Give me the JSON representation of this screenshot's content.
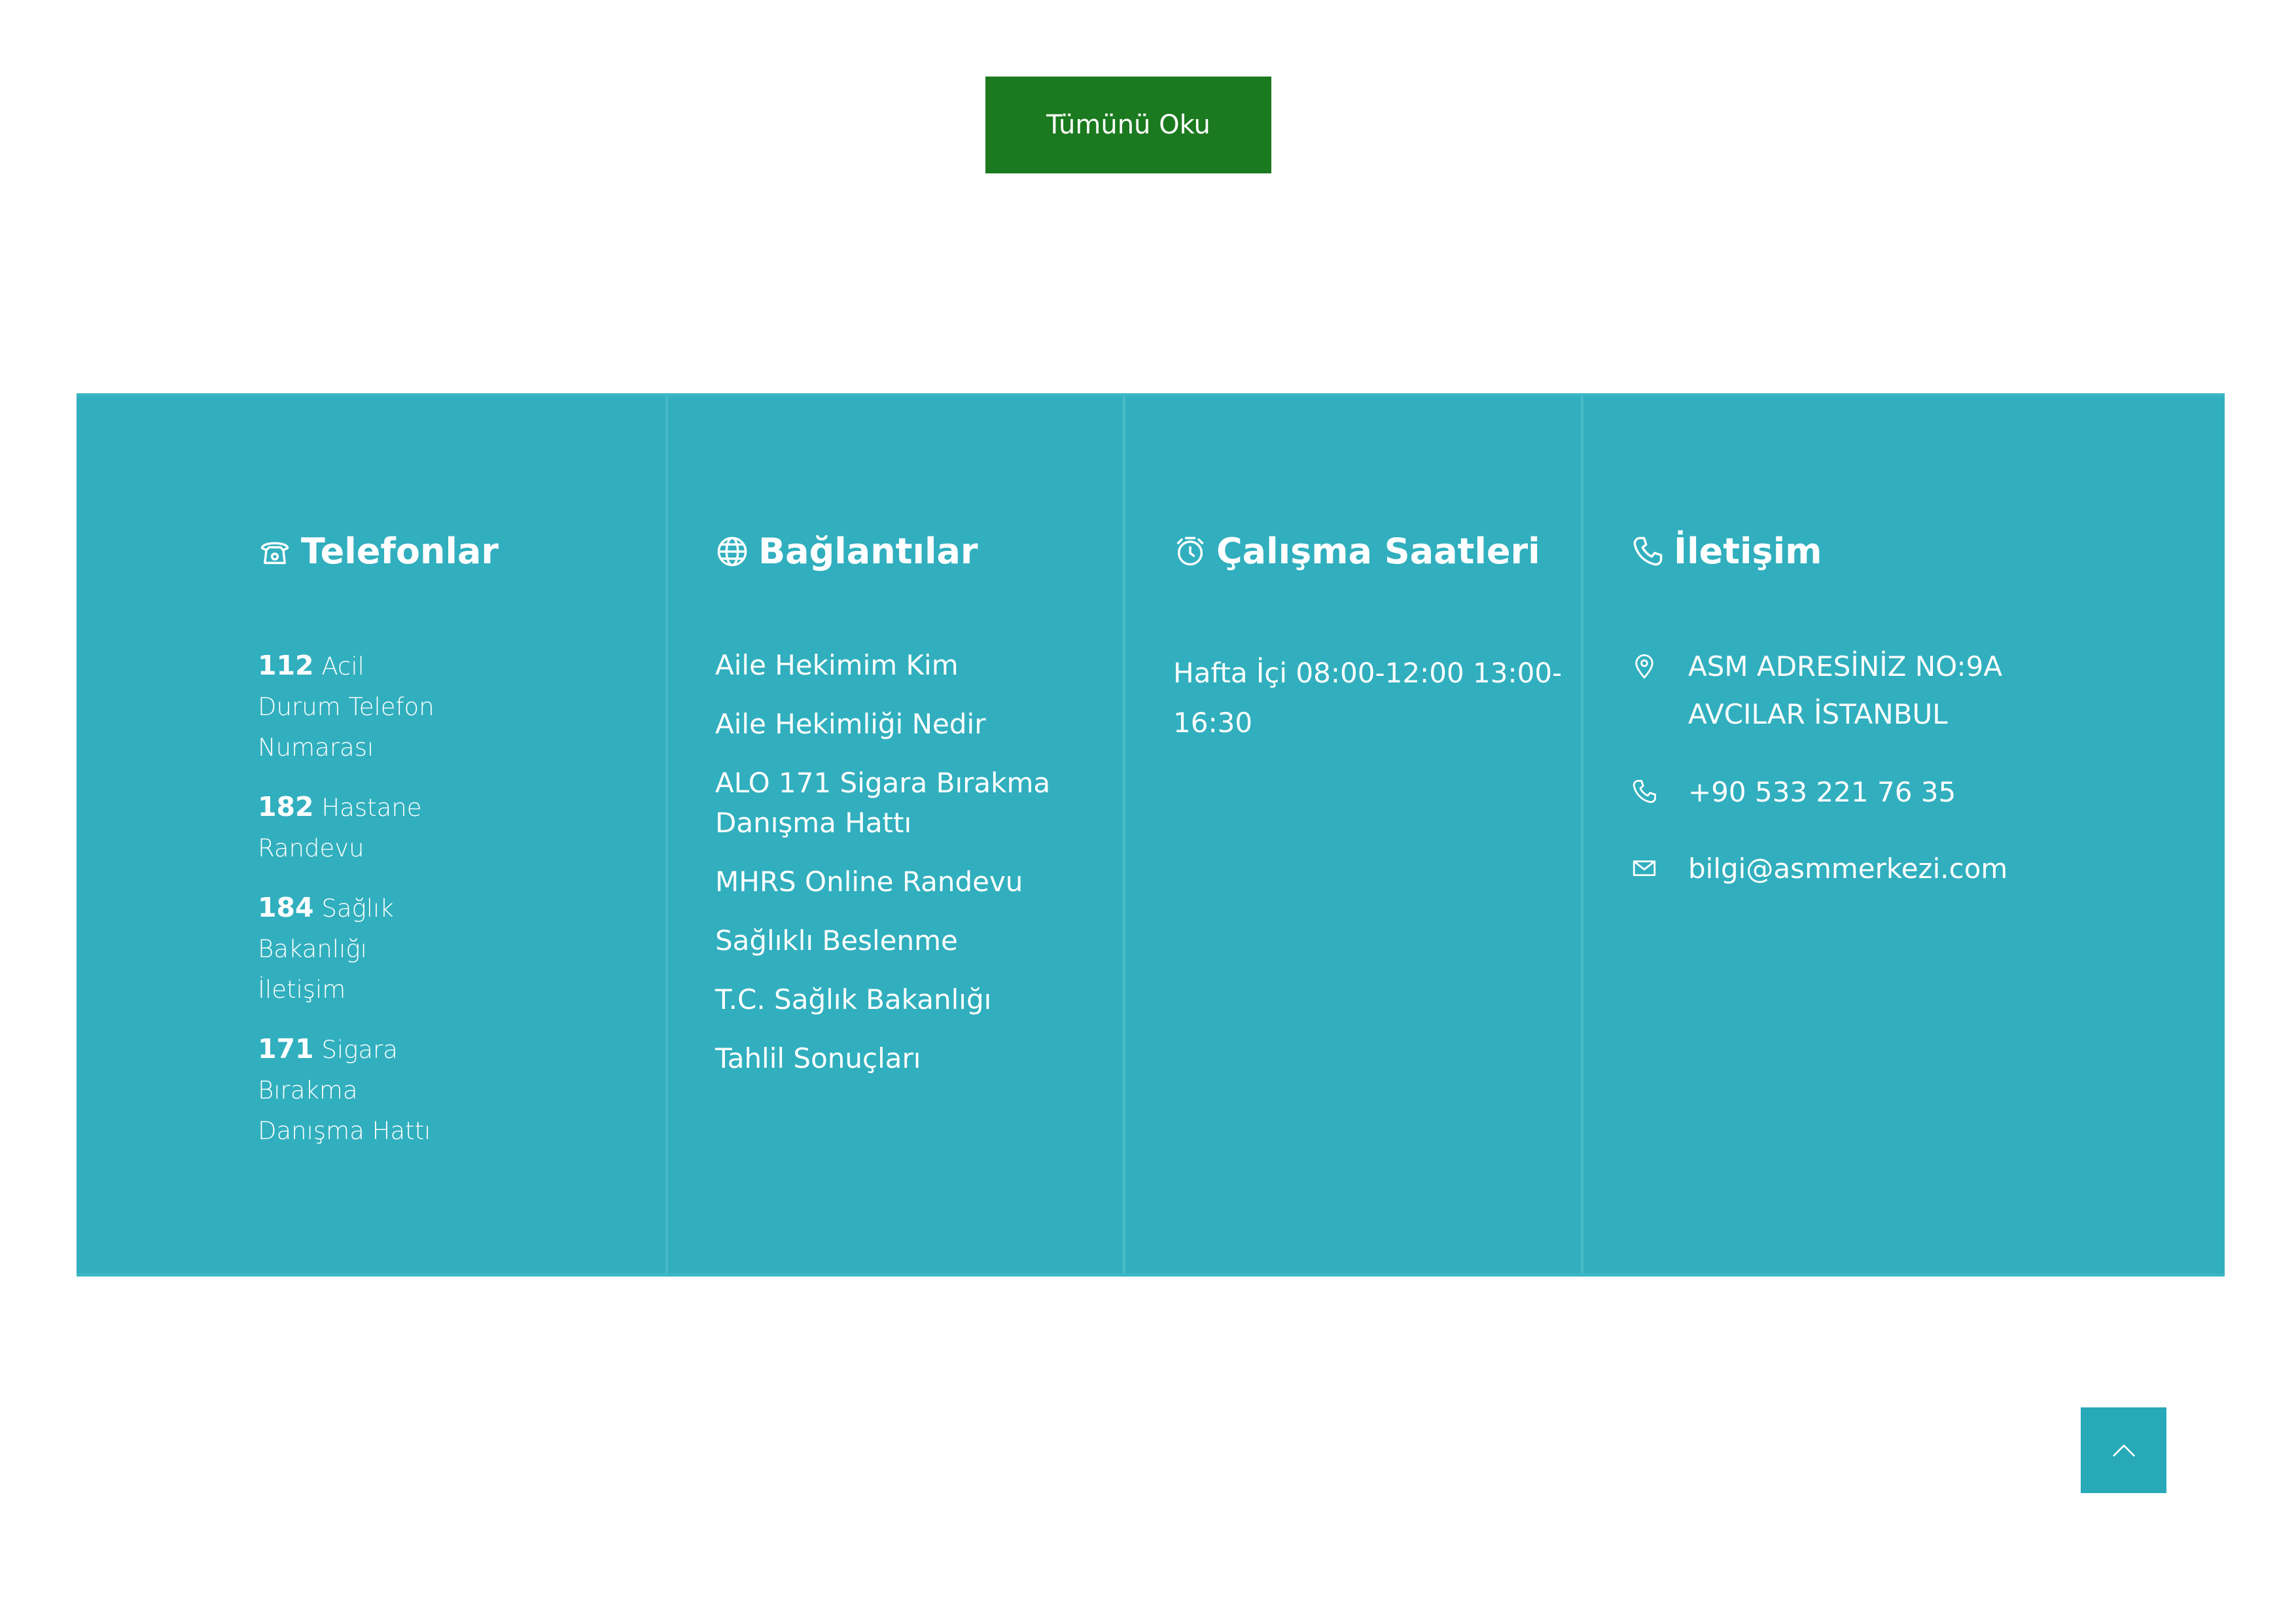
{
  "read_all_button": {
    "label": "Tümünü Oku",
    "color": "#1b7a1f"
  },
  "footer": {
    "background": "#31afbe",
    "phones": {
      "title": "Telefonlar",
      "icon": "telephone-icon",
      "items": [
        {
          "number": "112",
          "label": "Acil Durum Telefon Numarası"
        },
        {
          "number": "182",
          "label": "Hastane Randevu"
        },
        {
          "number": "184",
          "label": "Sağlık Bakanlığı İletişim"
        },
        {
          "number": "171",
          "label": "Sigara Bırakma Danışma Hattı"
        }
      ]
    },
    "links": {
      "title": "Bağlantılar",
      "icon": "globe-icon",
      "items": [
        "Aile Hekimim Kim",
        "Aile Hekimliği Nedir",
        "ALO 171 Sigara Bırakma Danışma Hattı",
        "MHRS Online Randevu",
        "Sağlıklı Beslenme",
        "T.C. Sağlık Bakanlığı",
        "Tahlil Sonuçları"
      ]
    },
    "hours": {
      "title": "Çalışma Saatleri",
      "icon": "alarm-clock-icon",
      "text": "Hafta İçi 08:00-12:00  13:00-16:30"
    },
    "contact": {
      "title": "İletişim",
      "icon": "phone-handset-icon",
      "address_line1": "ASM ADRESİNİZ NO:9A",
      "address_line2": "AVCILAR İSTANBUL",
      "phone": "+90 533 221 76 35",
      "email": "bilgi@asmmerkezi.com"
    }
  },
  "scroll_top_button": {
    "icon": "chevron-up-icon",
    "color": "#27a9b8"
  }
}
